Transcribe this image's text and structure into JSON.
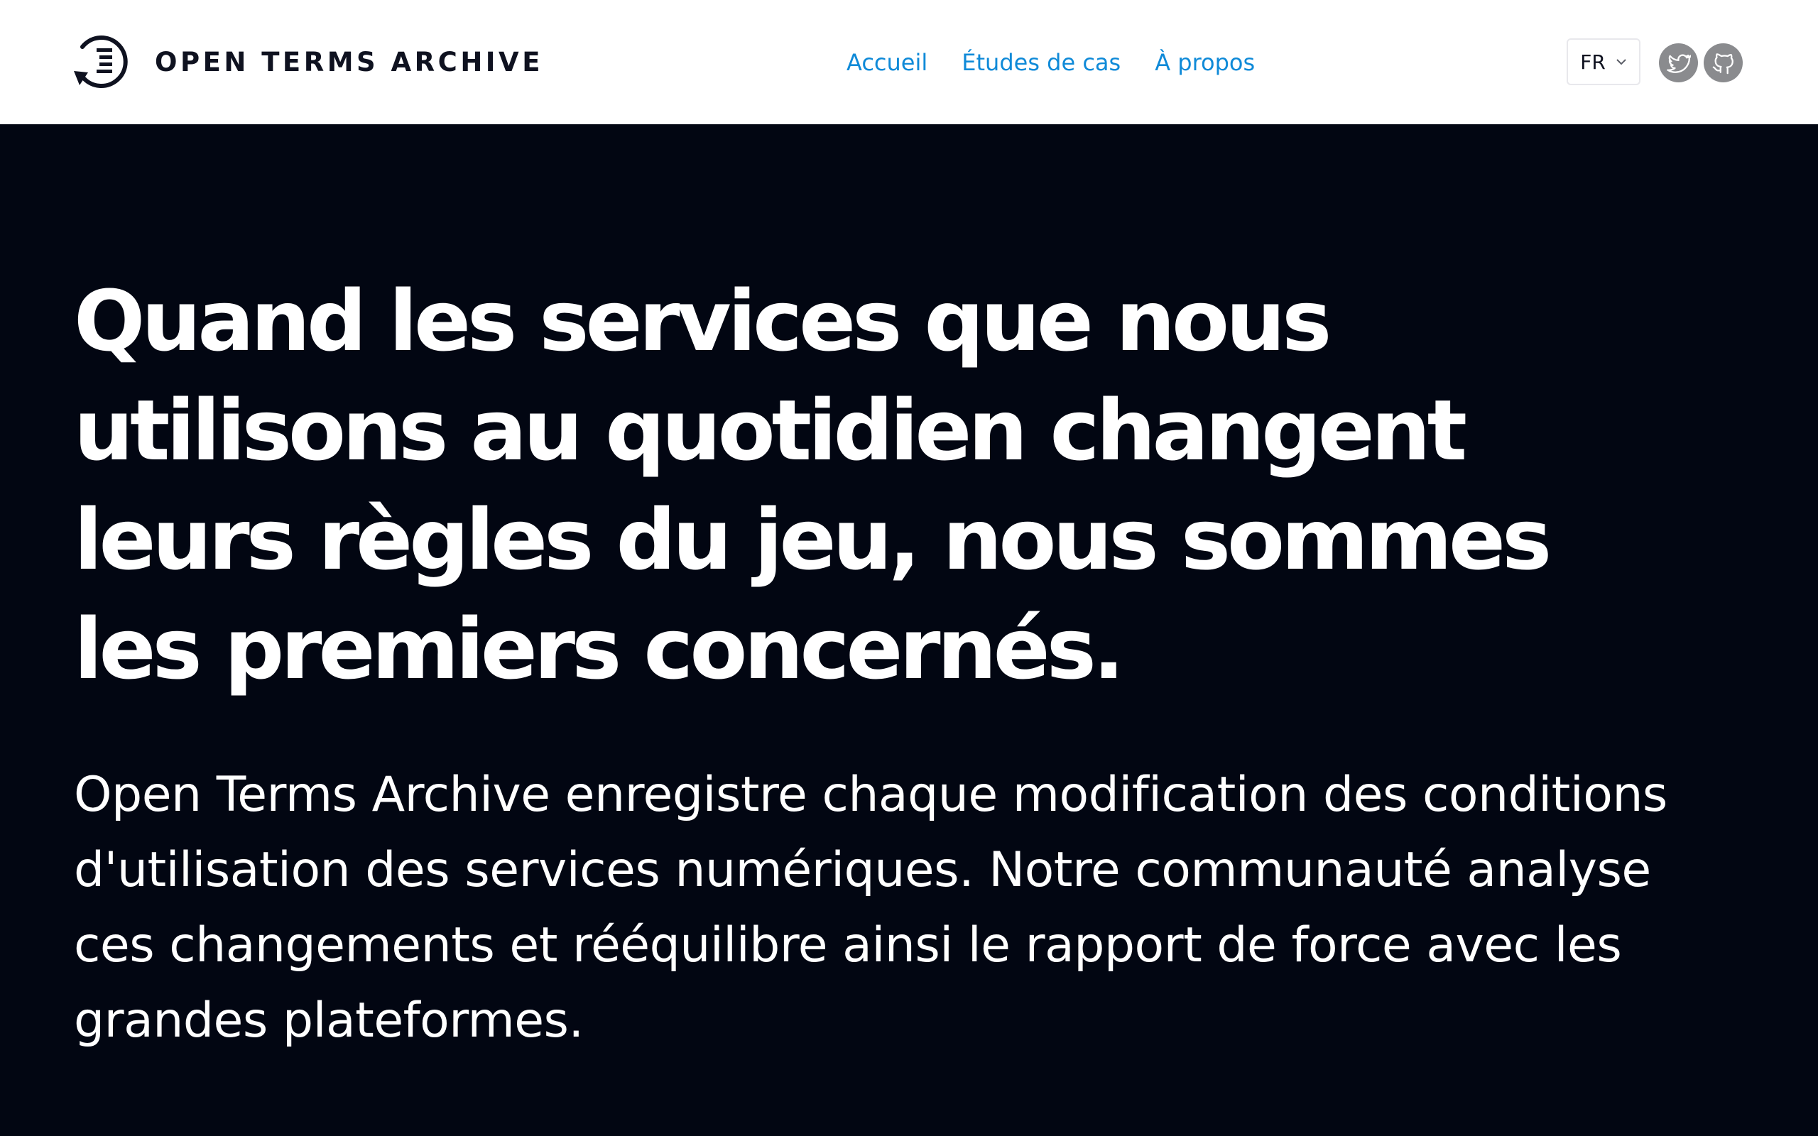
{
  "header": {
    "brand": "OPEN TERMS ARCHIVE",
    "nav": [
      {
        "label": "Accueil"
      },
      {
        "label": "Études de cas"
      },
      {
        "label": "À propos"
      }
    ],
    "language": {
      "selected": "FR"
    },
    "social": [
      {
        "icon": "twitter-icon"
      },
      {
        "icon": "github-icon"
      }
    ]
  },
  "hero": {
    "title_lines": [
      "Quand les services que nous",
      "utilisons au quotidien changent",
      "leurs règles du jeu, nous sommes",
      "les premiers concernés."
    ],
    "description_lines": [
      "Open Terms Archive enregistre chaque modification des conditions",
      "d'utilisation des services numériques. Notre communauté analyse",
      "ces changements et rééquilibre ainsi le rapport de force avec les",
      "grandes plateformes."
    ]
  },
  "colors": {
    "header_bg": "#ffffff",
    "hero_bg": "#020612",
    "nav_link": "#0f8ad8",
    "brand_text": "#0f1220",
    "social_icon_bg": "#8a8b8e"
  }
}
